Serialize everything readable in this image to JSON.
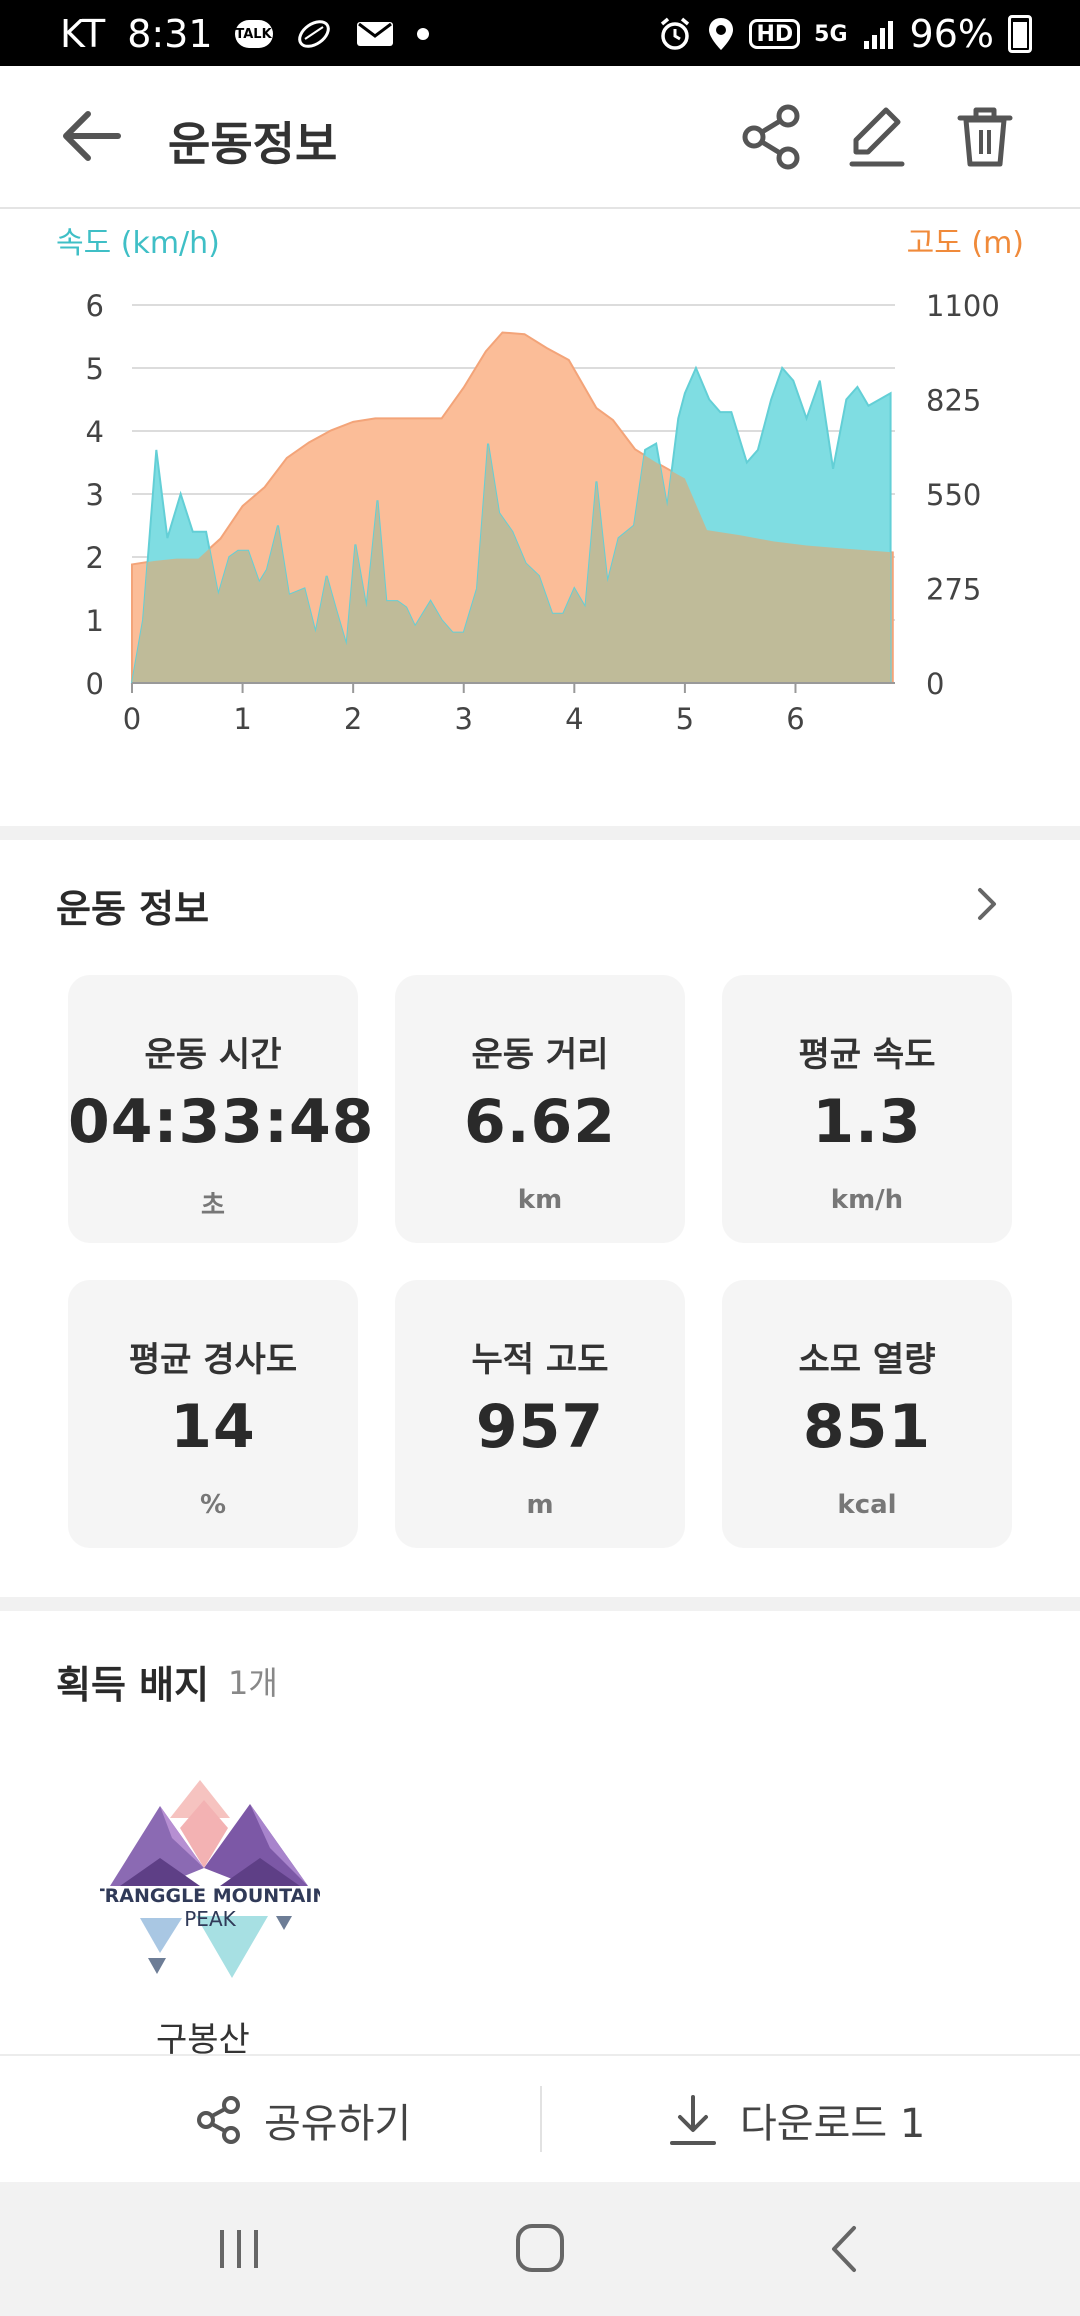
{
  "status_bar": {
    "carrier": "KT",
    "time": "8:31",
    "talk_label": "TALK",
    "hd_label": "HD",
    "net_label": "5G",
    "battery": "96%"
  },
  "app_bar": {
    "title": "운동정보"
  },
  "chart": {
    "left_axis_title": "속도 (km/h)",
    "right_axis_title": "고도 (m)",
    "left_ticks": [
      "6",
      "5",
      "4",
      "3",
      "2",
      "1",
      "0"
    ],
    "right_ticks": [
      "1100",
      "825",
      "550",
      "275",
      "0"
    ],
    "x_ticks": [
      "0",
      "1",
      "2",
      "3",
      "4",
      "5",
      "6"
    ]
  },
  "chart_data": {
    "type": "area",
    "ylim_left": [
      0,
      6
    ],
    "ylim_right": [
      0,
      1100
    ],
    "xlim": [
      0,
      6.9
    ],
    "colors": {
      "speed": "#7fdde2",
      "altitude": "#fbbd98",
      "overlap": "#bfbb99"
    },
    "series": [
      {
        "axis": "left",
        "x": [
          0,
          0.1,
          0.22,
          0.32,
          0.44,
          0.55,
          0.67,
          0.78,
          0.88,
          0.96,
          1.05,
          1.15,
          1.22,
          1.32,
          1.42,
          1.56,
          1.66,
          1.76,
          1.84,
          1.94,
          2.02,
          2.12,
          2.22,
          2.3,
          2.4,
          2.48,
          2.56,
          2.7,
          2.8,
          2.9,
          3.0,
          3.12,
          3.22,
          3.32,
          3.44,
          3.56,
          3.68,
          3.8,
          3.9,
          4.0,
          4.1,
          4.2,
          4.3,
          4.4,
          4.54,
          4.64,
          4.74,
          4.84,
          4.94,
          5.0,
          5.1,
          5.22,
          5.32,
          5.42,
          5.56,
          5.66,
          5.78,
          5.88,
          5.98,
          6.1,
          6.22,
          6.34,
          6.46,
          6.56,
          6.66,
          6.76,
          6.86
        ],
        "values": [
          0,
          1.0,
          3.7,
          2.3,
          3.0,
          2.4,
          2.4,
          1.4,
          2.0,
          2.1,
          2.1,
          1.6,
          1.8,
          2.5,
          1.4,
          1.5,
          0.8,
          1.7,
          1.2,
          0.6,
          2.2,
          1.2,
          2.9,
          1.3,
          1.3,
          1.2,
          0.9,
          1.3,
          1.0,
          0.8,
          0.8,
          1.5,
          3.8,
          2.7,
          2.4,
          1.9,
          1.7,
          1.1,
          1.1,
          1.5,
          1.2,
          3.2,
          1.6,
          2.3,
          2.5,
          3.7,
          3.8,
          2.8,
          4.2,
          4.6,
          5.0,
          4.5,
          4.3,
          4.3,
          3.5,
          3.7,
          4.5,
          5.0,
          4.8,
          4.2,
          4.8,
          3.4,
          4.5,
          4.7,
          4.4,
          4.5,
          4.6
        ]
      },
      {
        "axis": "right",
        "x": [
          0,
          0.2,
          0.4,
          0.6,
          0.8,
          1.0,
          1.2,
          1.4,
          1.6,
          1.8,
          2.0,
          2.2,
          2.4,
          2.6,
          2.8,
          3.0,
          3.2,
          3.35,
          3.55,
          3.75,
          3.95,
          4.2,
          4.35,
          4.55,
          4.75,
          5.0,
          5.2,
          5.5,
          5.8,
          6.1,
          6.4,
          6.7,
          6.88
        ],
        "values": [
          345,
          355,
          362,
          362,
          420,
          515,
          570,
          655,
          700,
          735,
          760,
          770,
          770,
          770,
          770,
          860,
          965,
          1020,
          1015,
          975,
          940,
          800,
          765,
          680,
          640,
          595,
          445,
          430,
          412,
          400,
          392,
          385,
          380
        ]
      }
    ]
  },
  "workout": {
    "section_title": "운동 정보",
    "cards": [
      {
        "label": "운동 시간",
        "value": "04:33:48",
        "unit": "초"
      },
      {
        "label": "운동 거리",
        "value": "6.62",
        "unit": "km"
      },
      {
        "label": "평균 속도",
        "value": "1.3",
        "unit": "km/h"
      },
      {
        "label": "평균 경사도",
        "value": "14",
        "unit": "%"
      },
      {
        "label": "누적 고도",
        "value": "957",
        "unit": "m"
      },
      {
        "label": "소모 열량",
        "value": "851",
        "unit": "kcal"
      }
    ]
  },
  "badges": {
    "section_title": "획득 배지",
    "count": "1개",
    "items": [
      {
        "logo_line1": "TRANGGLE MOUNTAIN",
        "logo_line2": "PEAK",
        "name": "구봉산"
      }
    ]
  },
  "bottom_bar": {
    "share_label": "공유하기",
    "download_label": "다운로드 1"
  }
}
